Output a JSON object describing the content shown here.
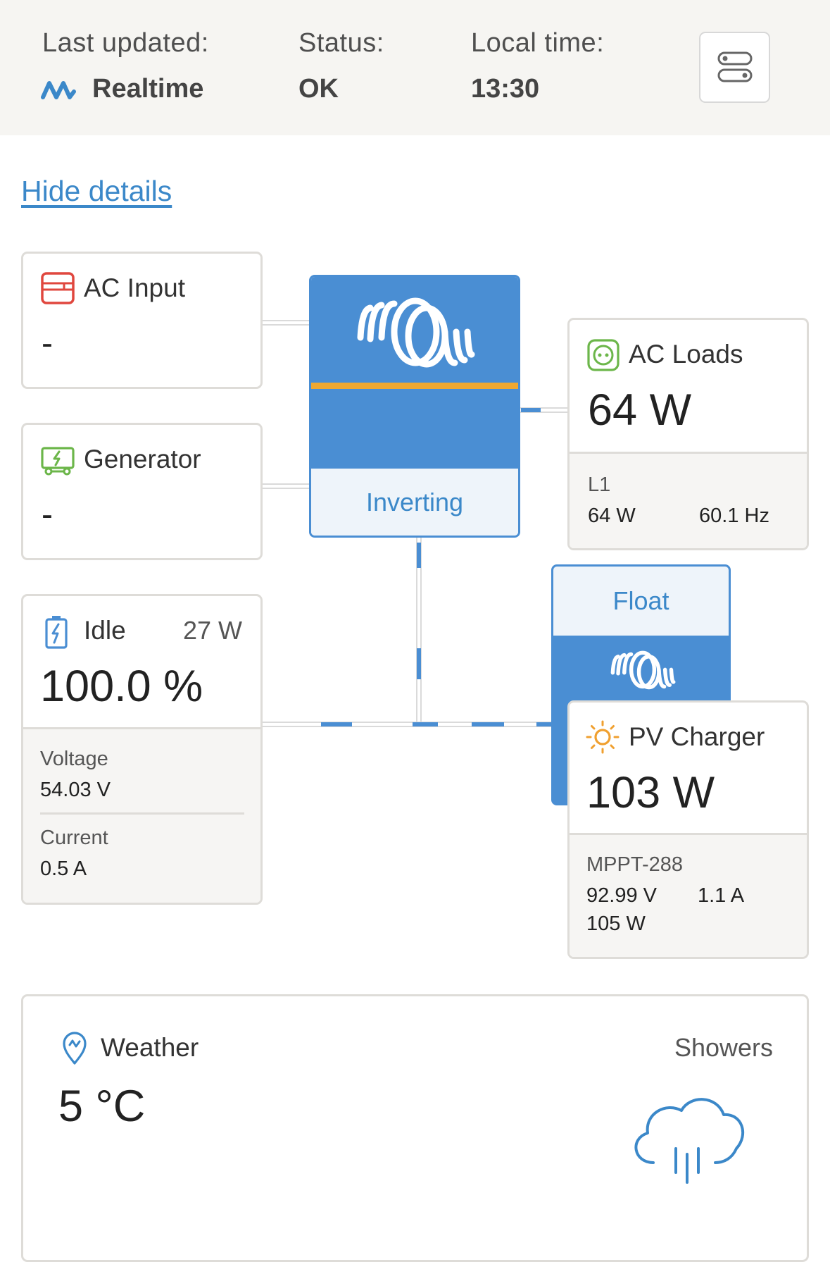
{
  "header": {
    "last_updated_label": "Last updated:",
    "last_updated_value": "Realtime",
    "status_label": "Status:",
    "status_value": "OK",
    "local_time_label": "Local time:",
    "local_time_value": "13:30"
  },
  "hide_details": "Hide details",
  "ac_input": {
    "title": "AC Input",
    "value": "-",
    "icon": "ac-input-icon"
  },
  "generator": {
    "title": "Generator",
    "value": "-",
    "icon": "generator-icon"
  },
  "inverter": {
    "state": "Inverting"
  },
  "ac_loads": {
    "title": "AC Loads",
    "value": "64 W",
    "phase": "L1",
    "phase_power": "64 W",
    "frequency": "60.1 Hz",
    "icon": "outlet-icon"
  },
  "battery": {
    "state": "Idle",
    "power": "27 W",
    "soc": "100.0 %",
    "voltage_label": "Voltage",
    "voltage": "54.03 V",
    "current_label": "Current",
    "current": "0.5 A",
    "icon": "battery-icon"
  },
  "solar_charger": {
    "state": "Float"
  },
  "pv_charger": {
    "title": "PV Charger",
    "value": "103 W",
    "device": "MPPT-288",
    "pv_voltage": "92.99 V",
    "pv_current": "1.1 A",
    "pv_power": "105 W",
    "icon": "sun-icon"
  },
  "weather": {
    "title": "Weather",
    "condition": "Showers",
    "temperature": "5 °C",
    "icon": "location-pin-icon",
    "condition_icon": "rain-cloud-icon"
  },
  "colors": {
    "accent": "#4a8ed3",
    "orange": "#f0a830",
    "ac_input_red": "#e0473e",
    "green": "#6cb64a",
    "battery_blue": "#4a8ed3",
    "sun_orange": "#f0a030"
  }
}
